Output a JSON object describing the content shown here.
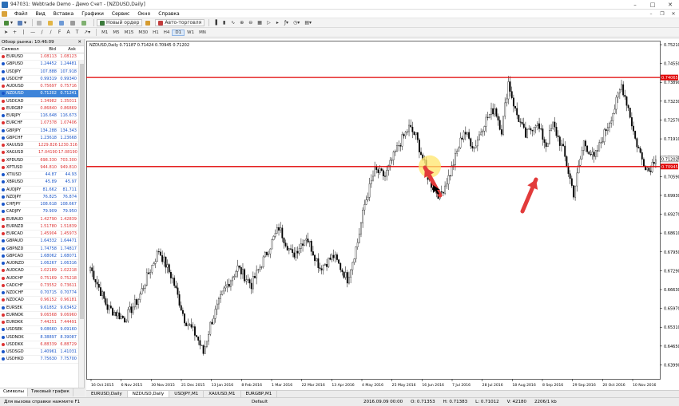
{
  "window": {
    "title": "947031: Webtrade Demo - Демо Счет - [NZDUSD,Daily]"
  },
  "menu": [
    "Файл",
    "Вид",
    "Вставка",
    "Графики",
    "Сервис",
    "Окно",
    "Справка"
  ],
  "toolbar": {
    "new_order": "Новый ордер",
    "auto_trading": "Авто-торговля"
  },
  "timeframes": [
    "M1",
    "M5",
    "M15",
    "M30",
    "H1",
    "H4",
    "D1",
    "W1",
    "MN"
  ],
  "active_timeframe": "D1",
  "market_watch": {
    "title": "Обзор рынка: 10:46:09",
    "columns": [
      "Символ",
      "Bid",
      "Ask"
    ],
    "selected_symbol": "NZDUSD",
    "symbols": [
      {
        "s": "EURUSD",
        "bid": "1.08113",
        "ask": "1.08123",
        "c": "#d33"
      },
      {
        "s": "GBPUSD",
        "bid": "1.24452",
        "ask": "1.24481",
        "c": "#1a56c9"
      },
      {
        "s": "USDJPY",
        "bid": "107.888",
        "ask": "107.918",
        "c": "#1a56c9"
      },
      {
        "s": "USDCHF",
        "bid": "0.99319",
        "ask": "0.99340",
        "c": "#1a56c9"
      },
      {
        "s": "AUDUSD",
        "bid": "0.75697",
        "ask": "0.75716",
        "c": "#d33"
      },
      {
        "s": "NZDUSD",
        "bid": "0.71202",
        "ask": "0.71241",
        "c": "#1a56c9"
      },
      {
        "s": "USDCAD",
        "bid": "1.34982",
        "ask": "1.35011",
        "c": "#d33"
      },
      {
        "s": "EURGBP",
        "bid": "0.86840",
        "ask": "0.86869",
        "c": "#d33"
      },
      {
        "s": "EURJPY",
        "bid": "116.648",
        "ask": "116.673",
        "c": "#1a56c9"
      },
      {
        "s": "EURCHF",
        "bid": "1.07378",
        "ask": "1.07406",
        "c": "#d33"
      },
      {
        "s": "GBPJPY",
        "bid": "134.288",
        "ask": "134.343",
        "c": "#1a56c9"
      },
      {
        "s": "GBPCHF",
        "bid": "1.23618",
        "ask": "1.23668",
        "c": "#1a56c9"
      },
      {
        "s": "XAUUSD",
        "bid": "1229.826",
        "ask": "1230.316",
        "c": "#d33"
      },
      {
        "s": "XAGUSD",
        "bid": "17.04190",
        "ask": "17.08190",
        "c": "#d33"
      },
      {
        "s": "XPDUSD",
        "bid": "698.330",
        "ask": "703.300",
        "c": "#d33"
      },
      {
        "s": "XPTUSD",
        "bid": "944.810",
        "ask": "949.810",
        "c": "#d33"
      },
      {
        "s": "XTIUSD",
        "bid": "44.87",
        "ask": "44.93",
        "c": "#1a56c9"
      },
      {
        "s": "XBRUSD",
        "bid": "45.89",
        "ask": "45.97",
        "c": "#1a56c9"
      },
      {
        "s": "AUDJPY",
        "bid": "81.662",
        "ask": "81.711",
        "c": "#1a56c9"
      },
      {
        "s": "NZDJPY",
        "bid": "76.825",
        "ask": "76.874",
        "c": "#1a56c9"
      },
      {
        "s": "CHFJPY",
        "bid": "108.618",
        "ask": "108.667",
        "c": "#1a56c9"
      },
      {
        "s": "CADJPY",
        "bid": "79.909",
        "ask": "79.950",
        "c": "#1a56c9"
      },
      {
        "s": "EURAUD",
        "bid": "1.42790",
        "ask": "1.42839",
        "c": "#d33"
      },
      {
        "s": "EURNZD",
        "bid": "1.51780",
        "ask": "1.51839",
        "c": "#d33"
      },
      {
        "s": "EURCAD",
        "bid": "1.45904",
        "ask": "1.45973",
        "c": "#d33"
      },
      {
        "s": "GBPAUD",
        "bid": "1.64332",
        "ask": "1.64471",
        "c": "#1a56c9"
      },
      {
        "s": "GBPNZD",
        "bid": "1.74758",
        "ask": "1.74817",
        "c": "#1a56c9"
      },
      {
        "s": "GBPCAD",
        "bid": "1.68062",
        "ask": "1.68071",
        "c": "#1a56c9"
      },
      {
        "s": "AUDNZD",
        "bid": "1.06267",
        "ask": "1.06316",
        "c": "#1a56c9"
      },
      {
        "s": "AUDCAD",
        "bid": "1.02189",
        "ask": "1.02218",
        "c": "#d33"
      },
      {
        "s": "AUDCHF",
        "bid": "0.75169",
        "ask": "0.75218",
        "c": "#d33"
      },
      {
        "s": "CADCHF",
        "bid": "0.73552",
        "ask": "0.73611",
        "c": "#d33"
      },
      {
        "s": "NZDCHF",
        "bid": "0.70715",
        "ask": "0.70774",
        "c": "#1a56c9"
      },
      {
        "s": "NZDCAD",
        "bid": "0.96152",
        "ask": "0.96181",
        "c": "#d33"
      },
      {
        "s": "EURSEK",
        "bid": "9.61852",
        "ask": "9.63452",
        "c": "#1a56c9"
      },
      {
        "s": "EURNOK",
        "bid": "9.06568",
        "ask": "9.06960",
        "c": "#d33"
      },
      {
        "s": "EURDKK",
        "bid": "7.44251",
        "ask": "7.44491",
        "c": "#d33"
      },
      {
        "s": "USDSEK",
        "bid": "9.08660",
        "ask": "9.09160",
        "c": "#1a56c9"
      },
      {
        "s": "USDNOK",
        "bid": "8.38897",
        "ask": "8.39087",
        "c": "#1a56c9"
      },
      {
        "s": "USDDKK",
        "bid": "6.88339",
        "ask": "6.88729",
        "c": "#d33"
      },
      {
        "s": "USDSGD",
        "bid": "1.40961",
        "ask": "1.41031",
        "c": "#1a56c9"
      },
      {
        "s": "USDHKD",
        "bid": "7.75630",
        "ask": "7.75700",
        "c": "#1a56c9"
      }
    ],
    "tabs": [
      "Символы",
      "Тиковый график"
    ]
  },
  "chart_tabs": [
    "EURUSD,Daily",
    "NZDUSD,Daily",
    "USDJPY,M1",
    "XAUUSD,M1",
    "EURGBP,M1"
  ],
  "active_chart_tab": "NZDUSD,Daily",
  "status": {
    "left": "Для вызова справки нажмите F1",
    "profile": "Default",
    "datetime": "2016.09.09 00:00",
    "open": "O: 0.71353",
    "high": "H: 0.71383",
    "low": "L: 0.71012",
    "vol": "V: 42180",
    "traffic": "2206/1 kb"
  },
  "chart_data": {
    "type": "candlestick",
    "legend": "NZDUSD,Daily 0.71187 0.71424 0.70945 0.71202",
    "ylim": [
      0.635,
      0.7535
    ],
    "y_ticks": [
      "0.75210",
      "0.74550",
      "0.73890",
      "0.73230",
      "0.72570",
      "0.71910",
      "0.71250",
      "0.70590",
      "0.69930",
      "0.69270",
      "0.68610",
      "0.67950",
      "0.67290",
      "0.66630",
      "0.65970",
      "0.65310",
      "0.64650",
      "0.63990"
    ],
    "x_ticks": [
      "16 Oct 2015",
      "6 Nov 2015",
      "30 Nov 2015",
      "21 Dec 2015",
      "13 Jan 2016",
      "8 Feb 2016",
      "1 Mar 2016",
      "22 Mar 2016",
      "13 Apr 2016",
      "4 May 2016",
      "25 May 2016",
      "16 Jun 2016",
      "7 Jul 2016",
      "28 Jul 2016",
      "18 Aug 2016",
      "8 Sep 2016",
      "29 Sep 2016",
      "20 Oct 2016",
      "10 Nov 2016"
    ],
    "hlines": [
      {
        "value": 0.7406,
        "label": "0.74065",
        "color": "#e00000"
      },
      {
        "value": 0.7094,
        "label": "0.70945",
        "color": "#e00000"
      }
    ],
    "current_price": "0.71202",
    "anchor_closes": [
      [
        0,
        0.674
      ],
      [
        10,
        0.66
      ],
      [
        20,
        0.656
      ],
      [
        28,
        0.663
      ],
      [
        34,
        0.672
      ],
      [
        40,
        0.68
      ],
      [
        48,
        0.67
      ],
      [
        55,
        0.656
      ],
      [
        62,
        0.65
      ],
      [
        66,
        0.644
      ],
      [
        70,
        0.654
      ],
      [
        78,
        0.666
      ],
      [
        86,
        0.674
      ],
      [
        94,
        0.668
      ],
      [
        102,
        0.678
      ],
      [
        110,
        0.688
      ],
      [
        118,
        0.678
      ],
      [
        126,
        0.685
      ],
      [
        134,
        0.674
      ],
      [
        142,
        0.678
      ],
      [
        150,
        0.67
      ],
      [
        156,
        0.683
      ],
      [
        160,
        0.696
      ],
      [
        166,
        0.708
      ],
      [
        172,
        0.706
      ],
      [
        180,
        0.717
      ],
      [
        186,
        0.723
      ],
      [
        190,
        0.72
      ],
      [
        198,
        0.704
      ],
      [
        204,
        0.699
      ],
      [
        210,
        0.707
      ],
      [
        218,
        0.722
      ],
      [
        224,
        0.716
      ],
      [
        230,
        0.725
      ],
      [
        236,
        0.73
      ],
      [
        240,
        0.722
      ],
      [
        244,
        0.739
      ],
      [
        248,
        0.729
      ],
      [
        254,
        0.72
      ],
      [
        260,
        0.725
      ],
      [
        266,
        0.717
      ],
      [
        270,
        0.724
      ],
      [
        276,
        0.715
      ],
      [
        282,
        0.7
      ],
      [
        288,
        0.718
      ],
      [
        294,
        0.712
      ],
      [
        300,
        0.721
      ],
      [
        306,
        0.73
      ],
      [
        310,
        0.738
      ],
      [
        314,
        0.73
      ],
      [
        318,
        0.719
      ],
      [
        322,
        0.712
      ],
      [
        326,
        0.708
      ],
      [
        330,
        0.7131
      ]
    ]
  }
}
